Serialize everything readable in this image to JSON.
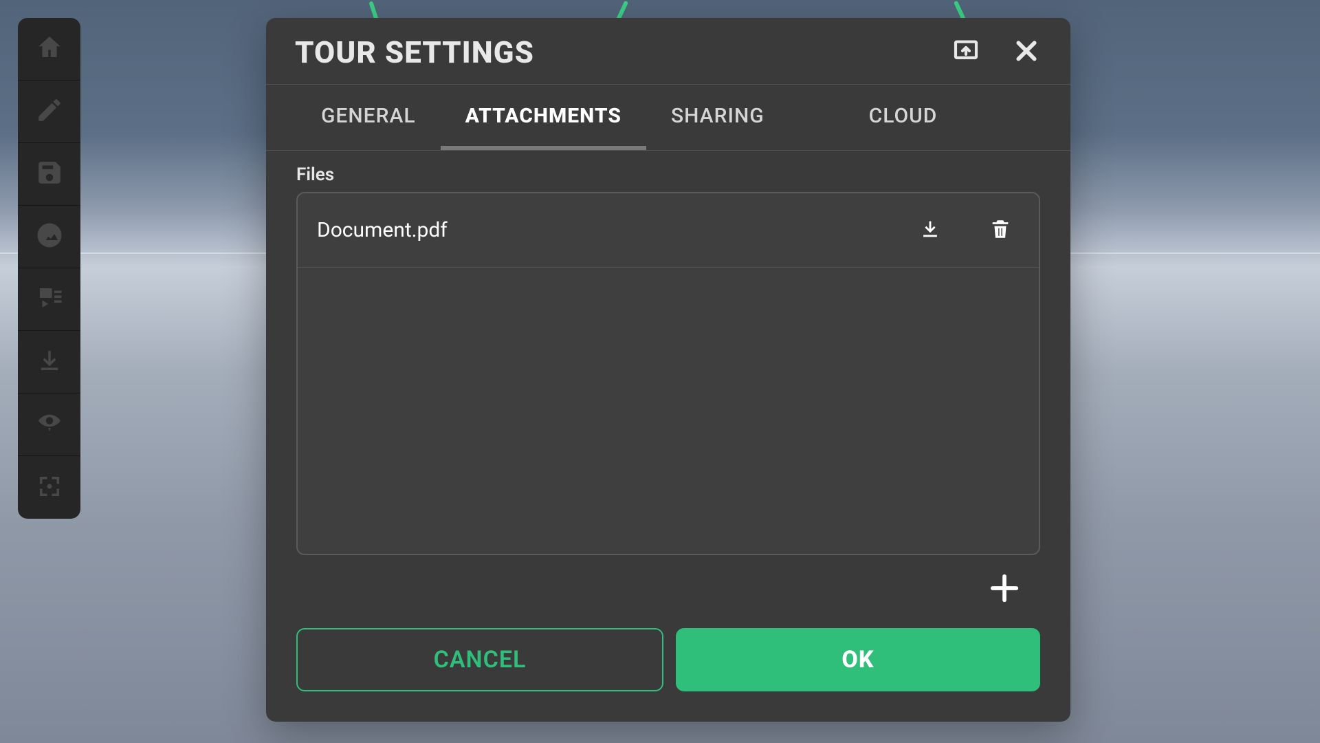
{
  "dialog": {
    "title": "TOUR SETTINGS",
    "tabs": {
      "general": "GENERAL",
      "attachments": "ATTACHMENTS",
      "sharing": "SHARING",
      "cloud": "CLOUD"
    },
    "active_tab": "attachments",
    "section_label": "Files",
    "files": [
      {
        "name": "Document.pdf"
      }
    ],
    "buttons": {
      "cancel": "CANCEL",
      "ok": "OK"
    }
  },
  "toolbar": {
    "items": [
      "home-icon",
      "edit-icon",
      "save-icon",
      "panorama-icon",
      "media-icon",
      "import-icon",
      "view-icon",
      "fullscreen-icon"
    ]
  },
  "colors": {
    "accent": "#2fbf7a",
    "panel": "#3a3a3a"
  }
}
